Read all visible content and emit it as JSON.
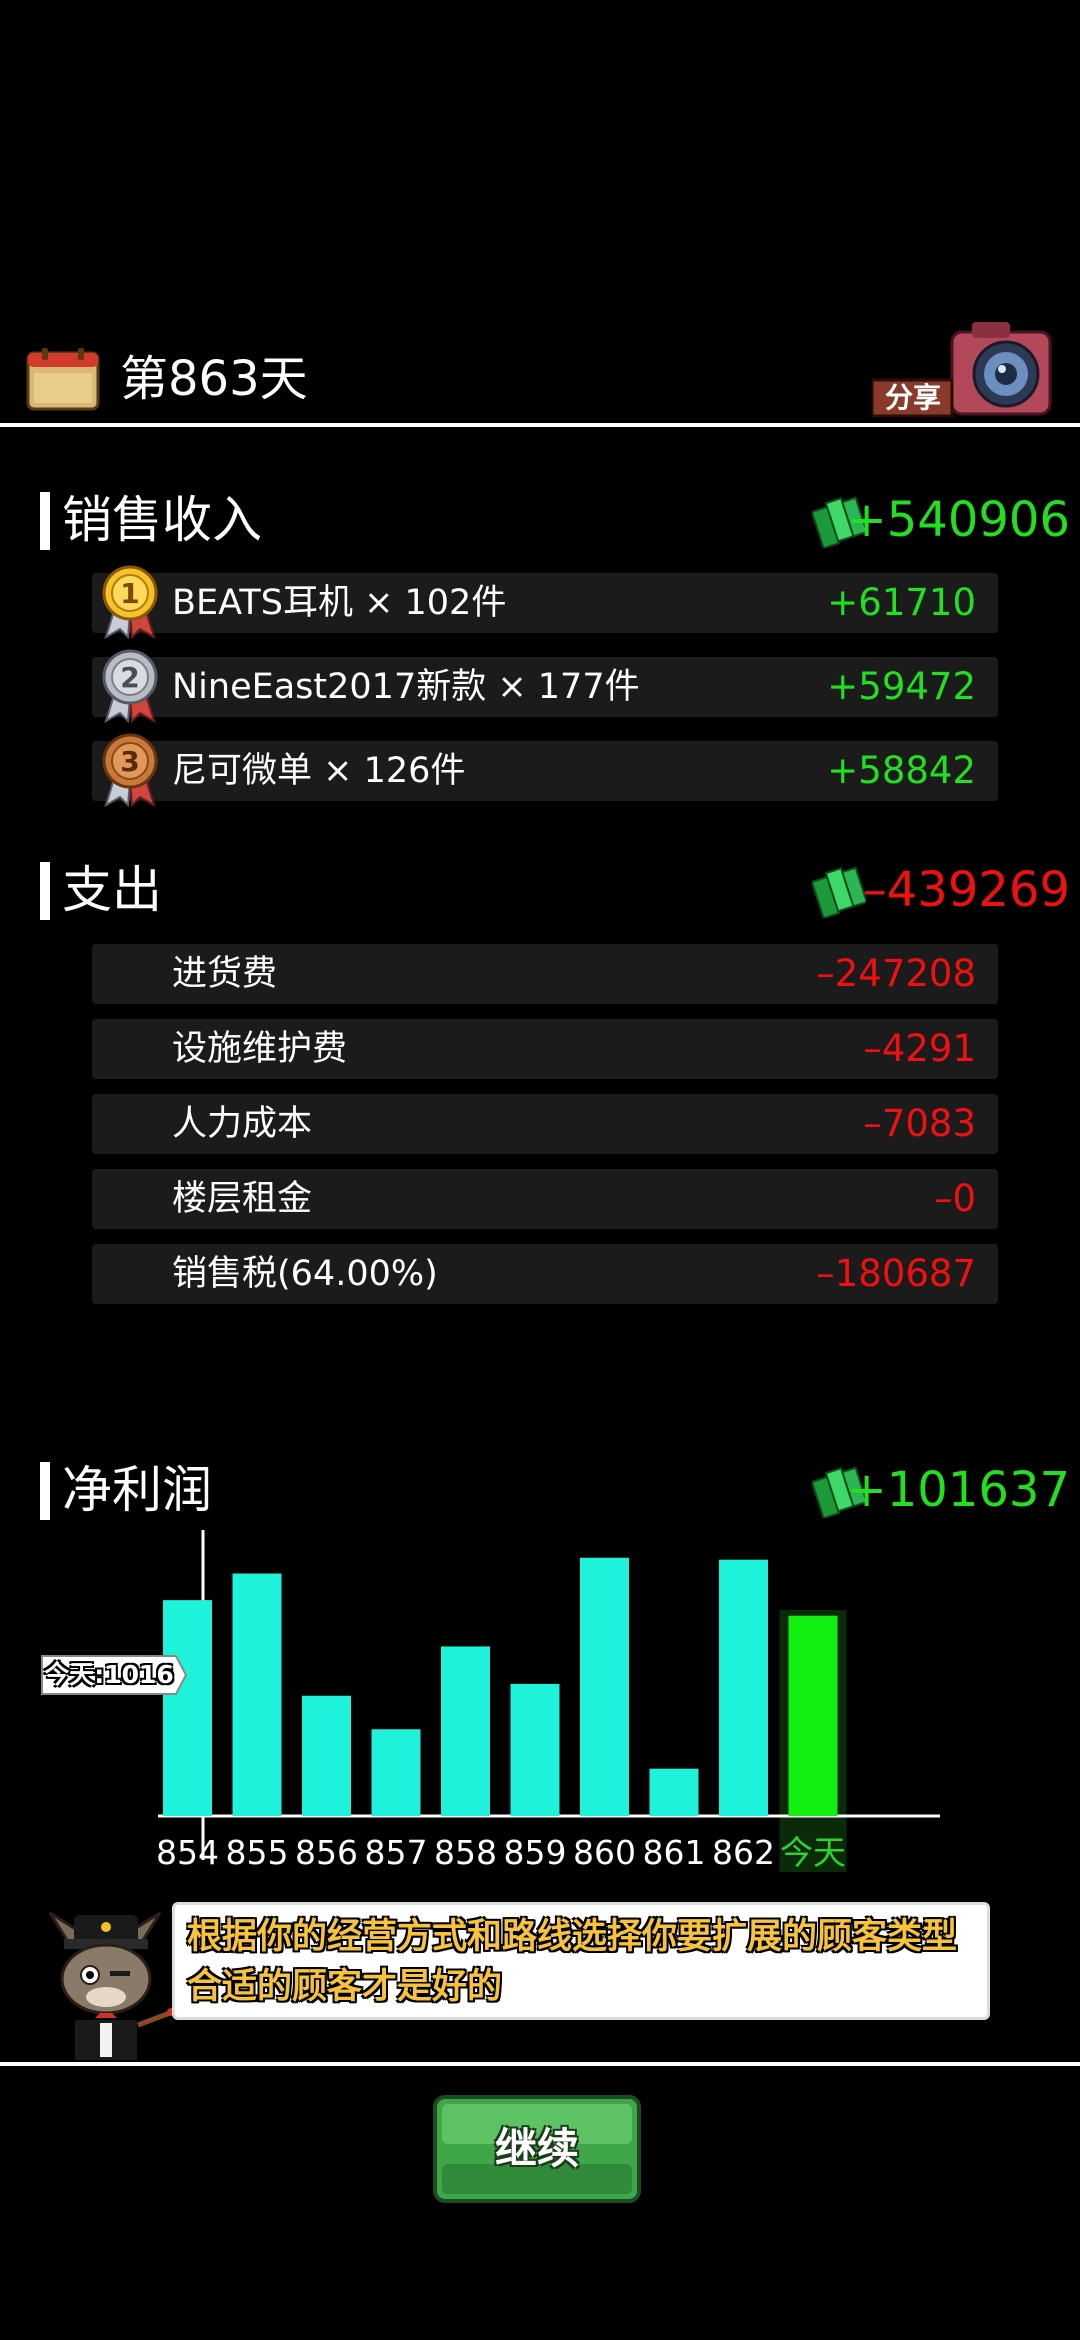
{
  "header": {
    "day_title": "第863天",
    "share_label": "分享"
  },
  "income": {
    "title": "销售收入",
    "total": "+540906",
    "items": [
      {
        "rank": "1",
        "label": "BEATS耳机 × 102件",
        "value": "+61710"
      },
      {
        "rank": "2",
        "label": "NineEast2017新款 × 177件",
        "value": "+59472"
      },
      {
        "rank": "3",
        "label": "尼可微单 × 126件",
        "value": "+58842"
      }
    ]
  },
  "expense": {
    "title": "支出",
    "total": "–439269",
    "items": [
      {
        "label": "进货费",
        "value": "–247208"
      },
      {
        "label": "设施维护费",
        "value": "–4291"
      },
      {
        "label": "人力成本",
        "value": "–7083"
      },
      {
        "label": "楼层租金",
        "value": "–0"
      },
      {
        "label": "销售税(64.00%)",
        "value": "–180687"
      }
    ]
  },
  "profit": {
    "title": "净利润",
    "total": "+101637",
    "today_tag": "今天:1016"
  },
  "chart_data": {
    "type": "bar",
    "categories": [
      "854",
      "855",
      "856",
      "857",
      "858",
      "859",
      "860",
      "861",
      "862",
      "今天"
    ],
    "values": [
      1095,
      1230,
      610,
      440,
      860,
      670,
      1310,
      240,
      1300,
      1016
    ],
    "ylim": [
      0,
      1400
    ],
    "colors": {
      "past": "#1ef2da",
      "today": "#12f012",
      "today_bg": "#0a2a0a",
      "today_label": "#2cd52c"
    }
  },
  "tip": {
    "line1": "根据你的经营方式和路线选择你要扩展的顾客类型",
    "line2": "合适的顾客才是好的"
  },
  "continue_label": "继续"
}
